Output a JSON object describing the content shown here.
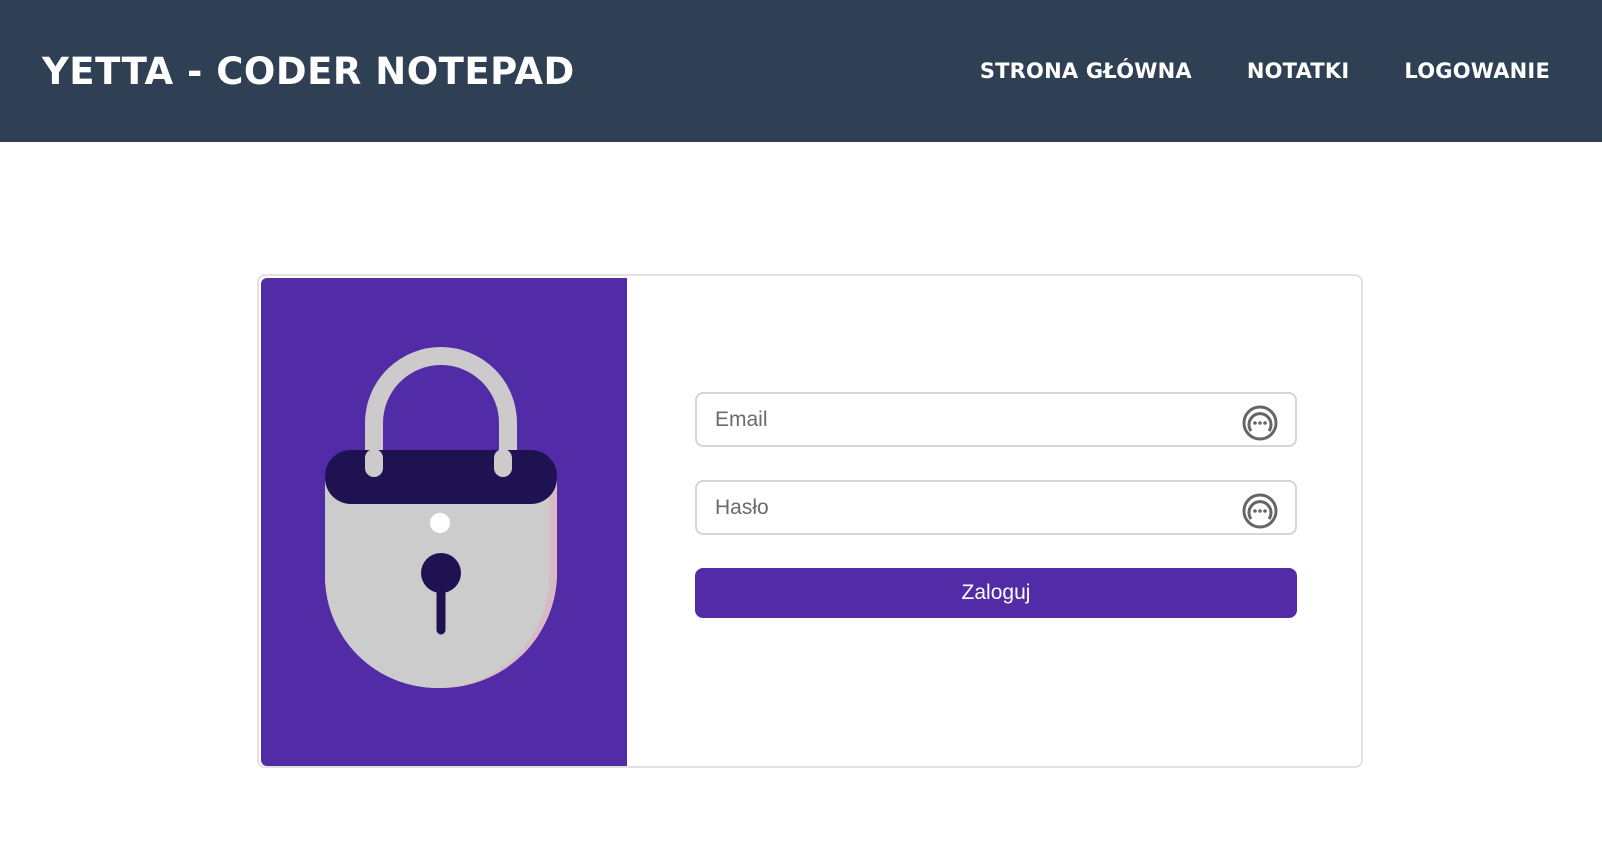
{
  "navbar": {
    "brand": "YETTA - CODER NOTEPAD",
    "links": [
      {
        "label": "STRONA GŁÓWNA"
      },
      {
        "label": "NOTATKI"
      },
      {
        "label": "LOGOWANIE"
      }
    ],
    "background_color": "#2f3f54"
  },
  "login": {
    "email_placeholder": "Email",
    "password_placeholder": "Hasło",
    "submit_label": "Zaloguj",
    "accent_color": "#522ba7",
    "illustration_icon": "padlock-icon",
    "field_icon": "password-manager-icon"
  }
}
